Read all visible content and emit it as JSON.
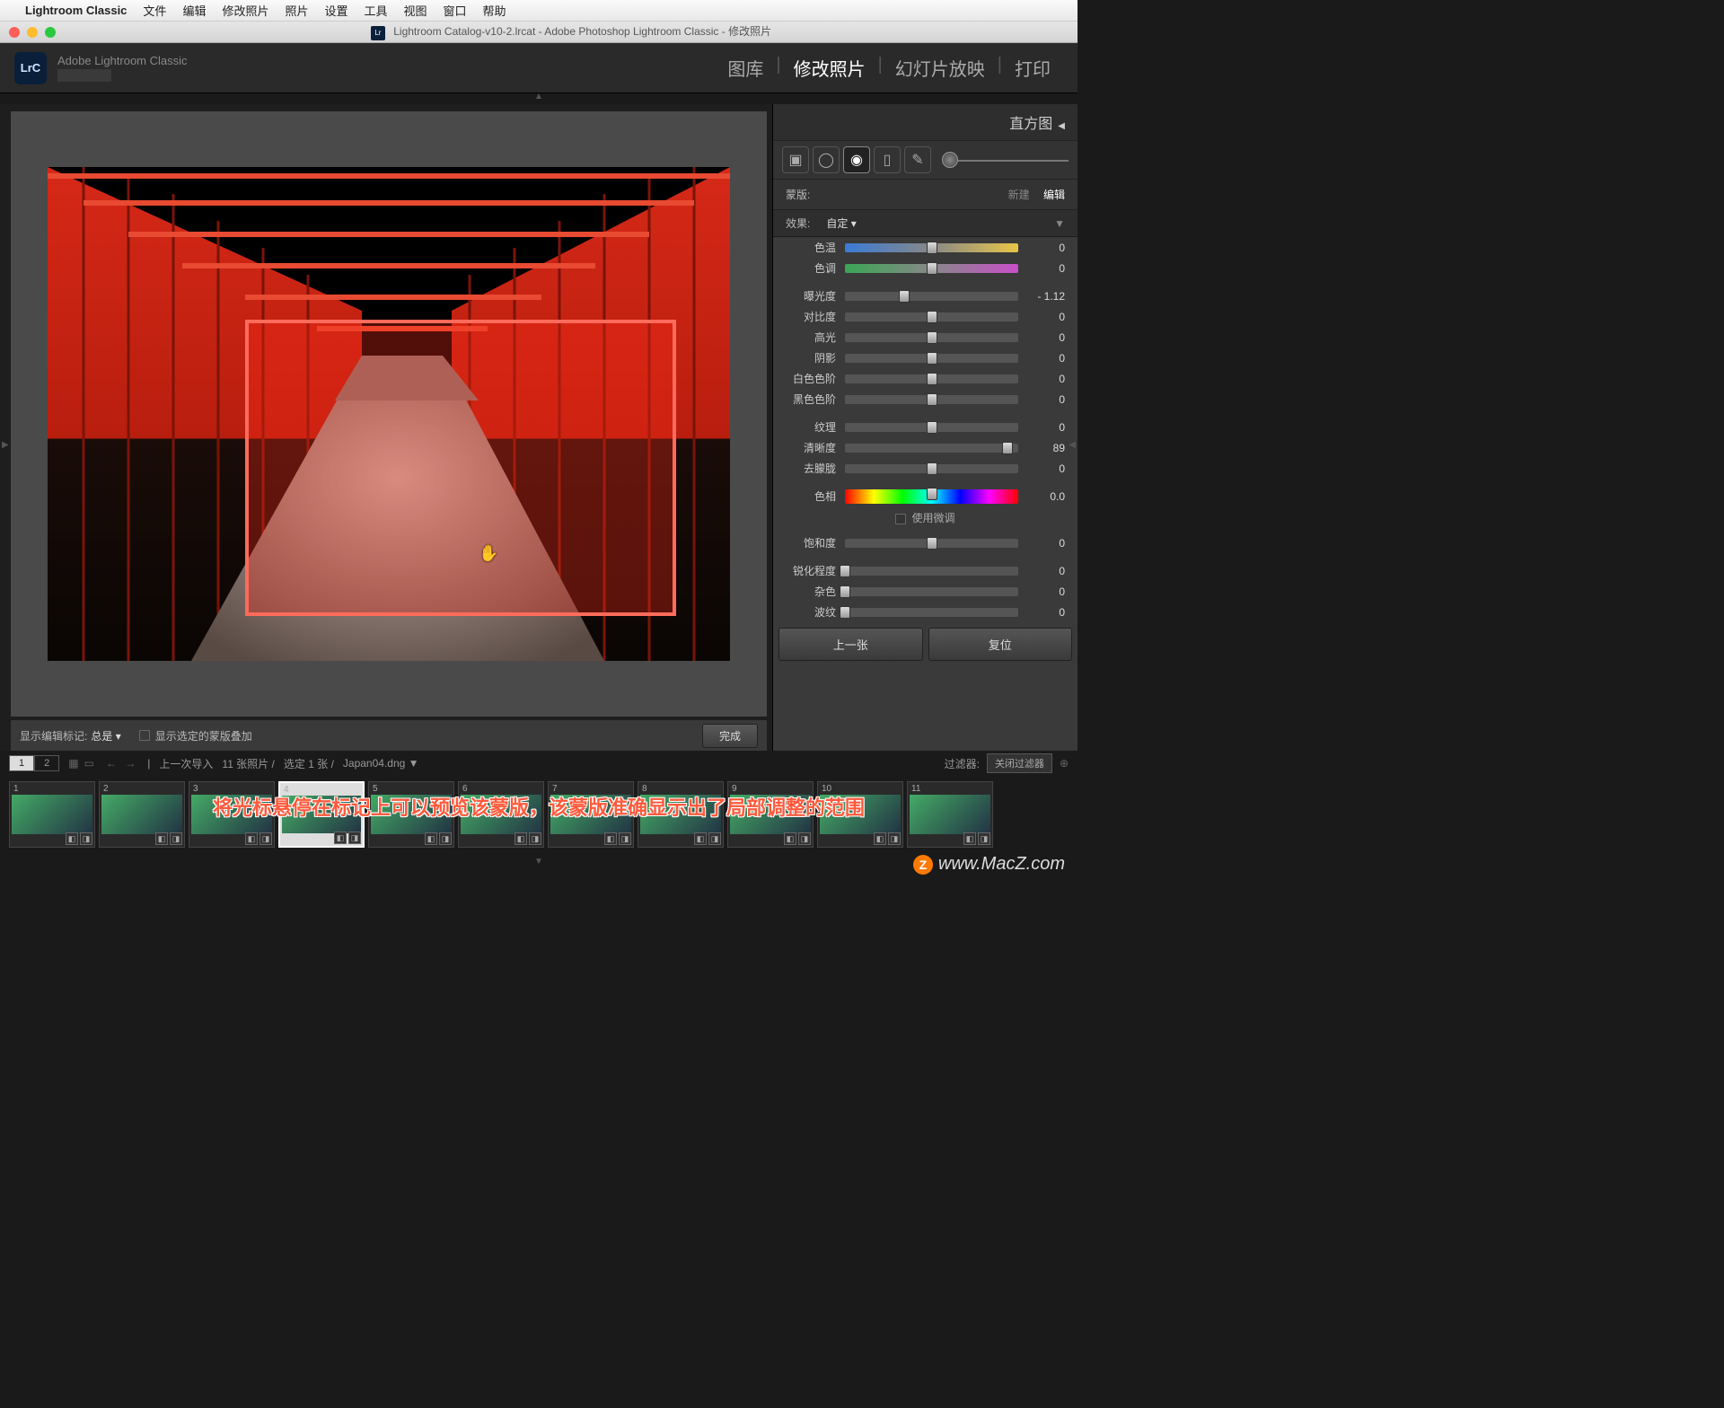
{
  "menubar": {
    "app_name": "Lightroom Classic",
    "items": [
      "文件",
      "编辑",
      "修改照片",
      "照片",
      "设置",
      "工具",
      "视图",
      "窗口",
      "帮助"
    ]
  },
  "titlebar": "Lightroom Catalog-v10-2.lrcat - Adobe Photoshop Lightroom Classic - 修改照片",
  "header": {
    "brand": "Adobe Lightroom Classic",
    "logo": "LrC",
    "modules": [
      "图库",
      "修改照片",
      "幻灯片放映",
      "打印"
    ],
    "active_module": "修改照片"
  },
  "right_panel": {
    "histogram_title": "直方图",
    "mask_label": "蒙版:",
    "mask_new": "新建",
    "mask_edit": "编辑",
    "effect_label": "效果:",
    "effect_preset": "自定",
    "sliders": [
      {
        "label": "色温",
        "value": "0",
        "pos": 50,
        "track": "temp"
      },
      {
        "label": "色调",
        "value": "0",
        "pos": 50,
        "track": "tint"
      },
      {
        "label": "曝光度",
        "value": "- 1.12",
        "pos": 34,
        "track": "plain"
      },
      {
        "label": "对比度",
        "value": "0",
        "pos": 50,
        "track": "plain"
      },
      {
        "label": "高光",
        "value": "0",
        "pos": 50,
        "track": "plain"
      },
      {
        "label": "阴影",
        "value": "0",
        "pos": 50,
        "track": "plain"
      },
      {
        "label": "白色色阶",
        "value": "0",
        "pos": 50,
        "track": "plain"
      },
      {
        "label": "黑色色阶",
        "value": "0",
        "pos": 50,
        "track": "plain"
      },
      {
        "label": "纹理",
        "value": "0",
        "pos": 50,
        "track": "plain"
      },
      {
        "label": "清晰度",
        "value": "89",
        "pos": 94,
        "track": "plain"
      },
      {
        "label": "去朦胧",
        "value": "0",
        "pos": 50,
        "track": "plain"
      },
      {
        "label": "色相",
        "value": "0.0",
        "pos": 50,
        "track": "hue"
      },
      {
        "label": "饱和度",
        "value": "0",
        "pos": 50,
        "track": "plain"
      },
      {
        "label": "锐化程度",
        "value": "0",
        "pos": 0,
        "track": "plain"
      },
      {
        "label": "杂色",
        "value": "0",
        "pos": 0,
        "track": "plain"
      },
      {
        "label": "波纹",
        "value": "0",
        "pos": 0,
        "track": "plain"
      }
    ],
    "fine_tune": "使用微调",
    "prev_btn": "上一张",
    "reset_btn": "复位"
  },
  "canvas_toolbar": {
    "show_pins_label": "显示编辑标记:",
    "show_pins_value": "总是",
    "mask_overlay": "显示选定的蒙版叠加",
    "done": "完成"
  },
  "filmstrip_bar": {
    "view1": "1",
    "view2": "2",
    "breadcrumb": "上一次导入",
    "count": "11 张照片 /",
    "selected": "选定 1 张 /",
    "filename": "Japan04.dng",
    "filter_label": "过滤器:",
    "filter_value": "关闭过滤器"
  },
  "thumbs": [
    "1",
    "2",
    "3",
    "4",
    "5",
    "6",
    "7",
    "8",
    "9",
    "10",
    "11"
  ],
  "overlay_caption": "将光标悬停在标记上可以预览该蒙版，该蒙版准确显示出了局部调整的范围",
  "watermark": "www.MacZ.com"
}
